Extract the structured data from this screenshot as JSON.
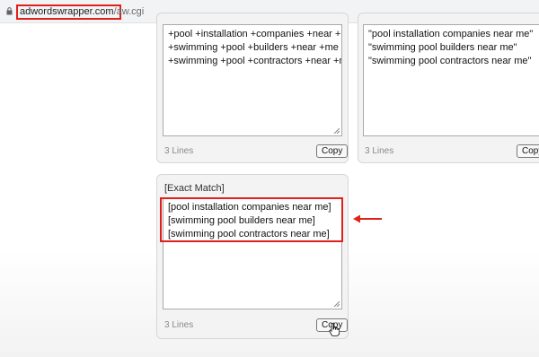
{
  "browser": {
    "url_host": "adwordswrapper.com",
    "url_path": "/aw.cgi"
  },
  "modified_broad_panel": {
    "lines": [
      "+pool +installation +companies +near +me",
      "+swimming +pool +builders +near +me",
      "+swimming +pool +contractors +near +me"
    ],
    "line_count": "3 Lines",
    "copy_label": "Copy"
  },
  "phrase_panel": {
    "lines": [
      "\"pool installation companies near me\"",
      "\"swimming pool builders near me\"",
      "\"swimming pool contractors near me\""
    ],
    "line_count": "3 Lines",
    "copy_label": "Copy"
  },
  "exact_panel": {
    "title": "[Exact Match]",
    "lines": [
      "[pool installation companies near me]",
      "[swimming pool builders near me]",
      "[swimming pool contractors near me]"
    ],
    "line_count": "3 Lines",
    "copy_label": "Copy"
  },
  "colors": {
    "highlight": "#e0201b",
    "panel_bg": "#f3f3f3"
  },
  "icons": [
    "lock-icon",
    "resize-grip-icon",
    "left-arrow-icon",
    "hand-cursor-icon"
  ]
}
